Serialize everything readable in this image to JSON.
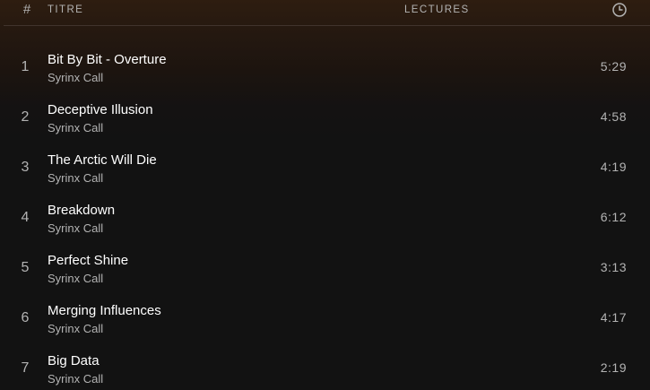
{
  "header": {
    "num_label": "#",
    "title_label": "TITRE",
    "plays_label": "LECTURES",
    "duration_icon": "clock-icon"
  },
  "tracks": [
    {
      "num": "1",
      "title": "Bit By Bit - Overture",
      "artist": "Syrinx Call",
      "duration": "5:29"
    },
    {
      "num": "2",
      "title": "Deceptive Illusion",
      "artist": "Syrinx Call",
      "duration": "4:58"
    },
    {
      "num": "3",
      "title": "The Arctic Will Die",
      "artist": "Syrinx Call",
      "duration": "4:19"
    },
    {
      "num": "4",
      "title": "Breakdown",
      "artist": "Syrinx Call",
      "duration": "6:12"
    },
    {
      "num": "5",
      "title": "Perfect Shine",
      "artist": "Syrinx Call",
      "duration": "3:13"
    },
    {
      "num": "6",
      "title": "Merging Influences",
      "artist": "Syrinx Call",
      "duration": "4:17"
    },
    {
      "num": "7",
      "title": "Big Data",
      "artist": "Syrinx Call",
      "duration": "2:19"
    }
  ]
}
